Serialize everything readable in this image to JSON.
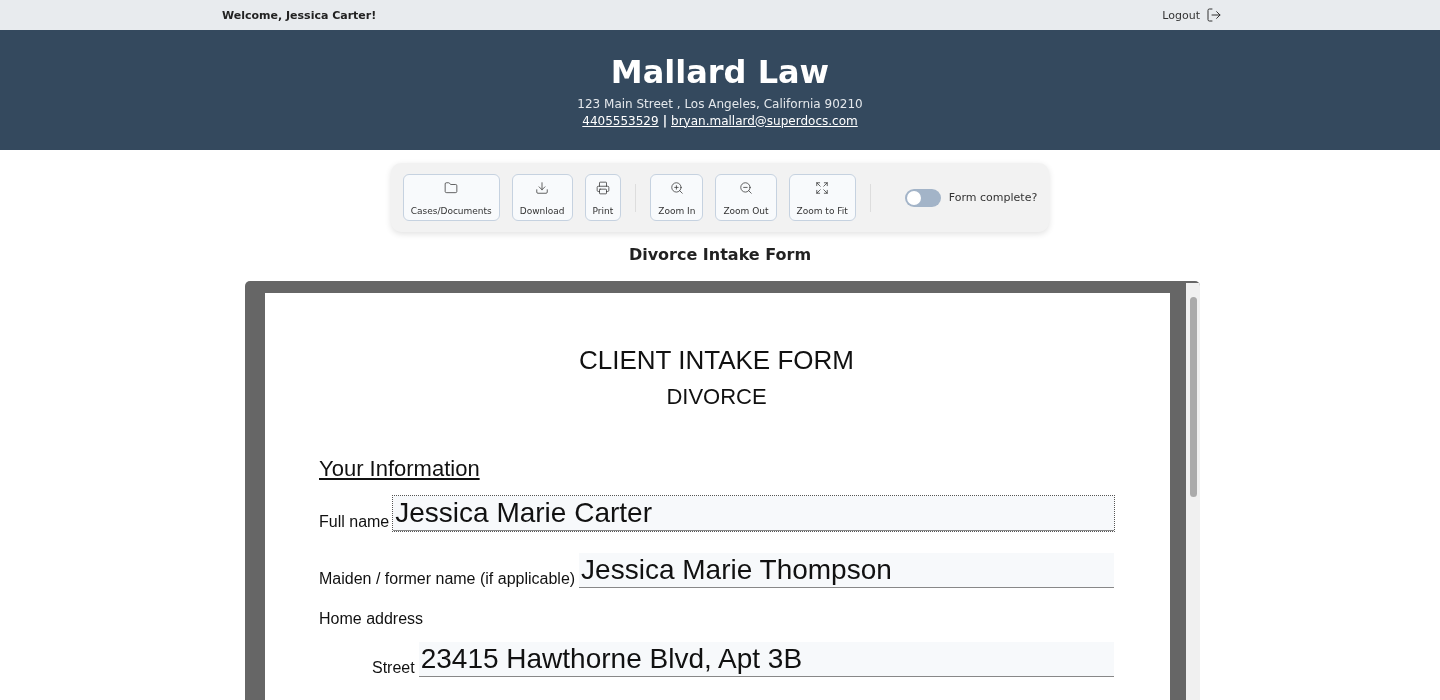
{
  "topbar": {
    "welcome": "Welcome, Jessica Carter!",
    "logout": "Logout"
  },
  "header": {
    "firm": "Mallard Law",
    "address": "123 Main Street , Los Angeles, California 90210",
    "phone": "4405553529",
    "separator": "|",
    "email": "bryan.mallard@superdocs.com"
  },
  "toolbar": {
    "groups": [
      [
        {
          "kind": "folder",
          "label": "Cases/Documents"
        },
        {
          "kind": "download",
          "label": "Download"
        },
        {
          "kind": "print",
          "label": "Print"
        }
      ],
      [
        {
          "kind": "zoom-in",
          "label": "Zoom In"
        },
        {
          "kind": "zoom-out",
          "label": "Zoom Out"
        },
        {
          "kind": "fit",
          "label": "Zoom to Fit"
        }
      ]
    ],
    "toggle": {
      "label": "Form complete?",
      "on": false
    }
  },
  "form_title": "Divorce Intake Form",
  "document": {
    "title": "CLIENT INTAKE FORM",
    "subtitle": "DIVORCE",
    "section": "Your Information",
    "items": [
      {
        "kind": "field",
        "label": "Full name",
        "value": "Jessica Marie Carter",
        "focused": true
      },
      {
        "kind": "field",
        "label": "Maiden / former name (if applicable)",
        "value": "Jessica Marie Thompson",
        "focused": false
      },
      {
        "kind": "group",
        "label": "Home address",
        "children": [
          {
            "kind": "field",
            "label": "Street",
            "value": "23415 Hawthorne Blvd, Apt 3B",
            "focused": false
          }
        ]
      }
    ]
  }
}
